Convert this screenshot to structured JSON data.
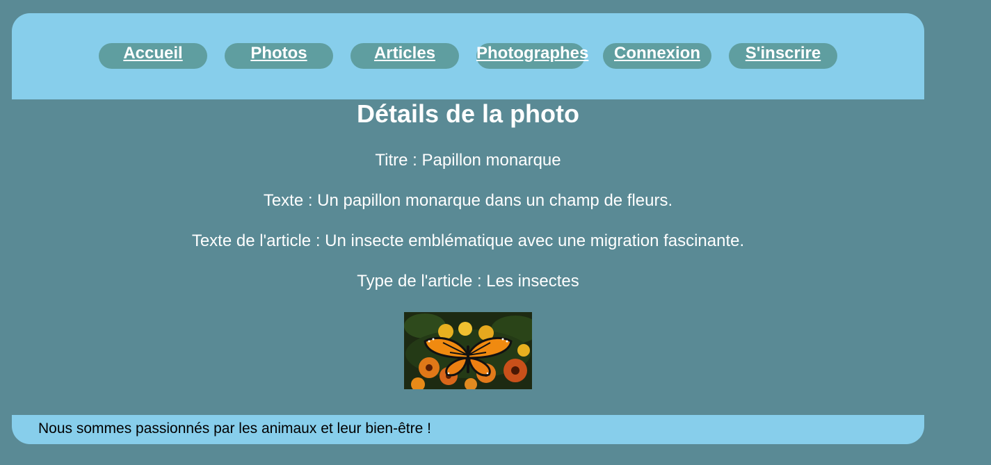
{
  "nav": {
    "items": [
      {
        "label": "Accueil"
      },
      {
        "label": "Photos"
      },
      {
        "label": "Articles"
      },
      {
        "label": "Photographes"
      },
      {
        "label": "Connexion"
      },
      {
        "label": "S'inscrire"
      }
    ]
  },
  "main": {
    "heading": "Détails de la photo",
    "title_line": "Titre : Papillon monarque",
    "text_line": "Texte : Un papillon monarque dans un champ de fleurs.",
    "article_text_line": "Texte de l'article : Un insecte emblématique avec une migration fascinante.",
    "article_type_line": "Type de l'article : Les insectes"
  },
  "footer": {
    "text": "Nous sommes passionnés par les animaux et leur bien-être !"
  },
  "colors": {
    "page_background": "#5a8a95",
    "header_background": "#87ceeb",
    "nav_button": "#5f9ea0",
    "text": "#ffffff"
  }
}
